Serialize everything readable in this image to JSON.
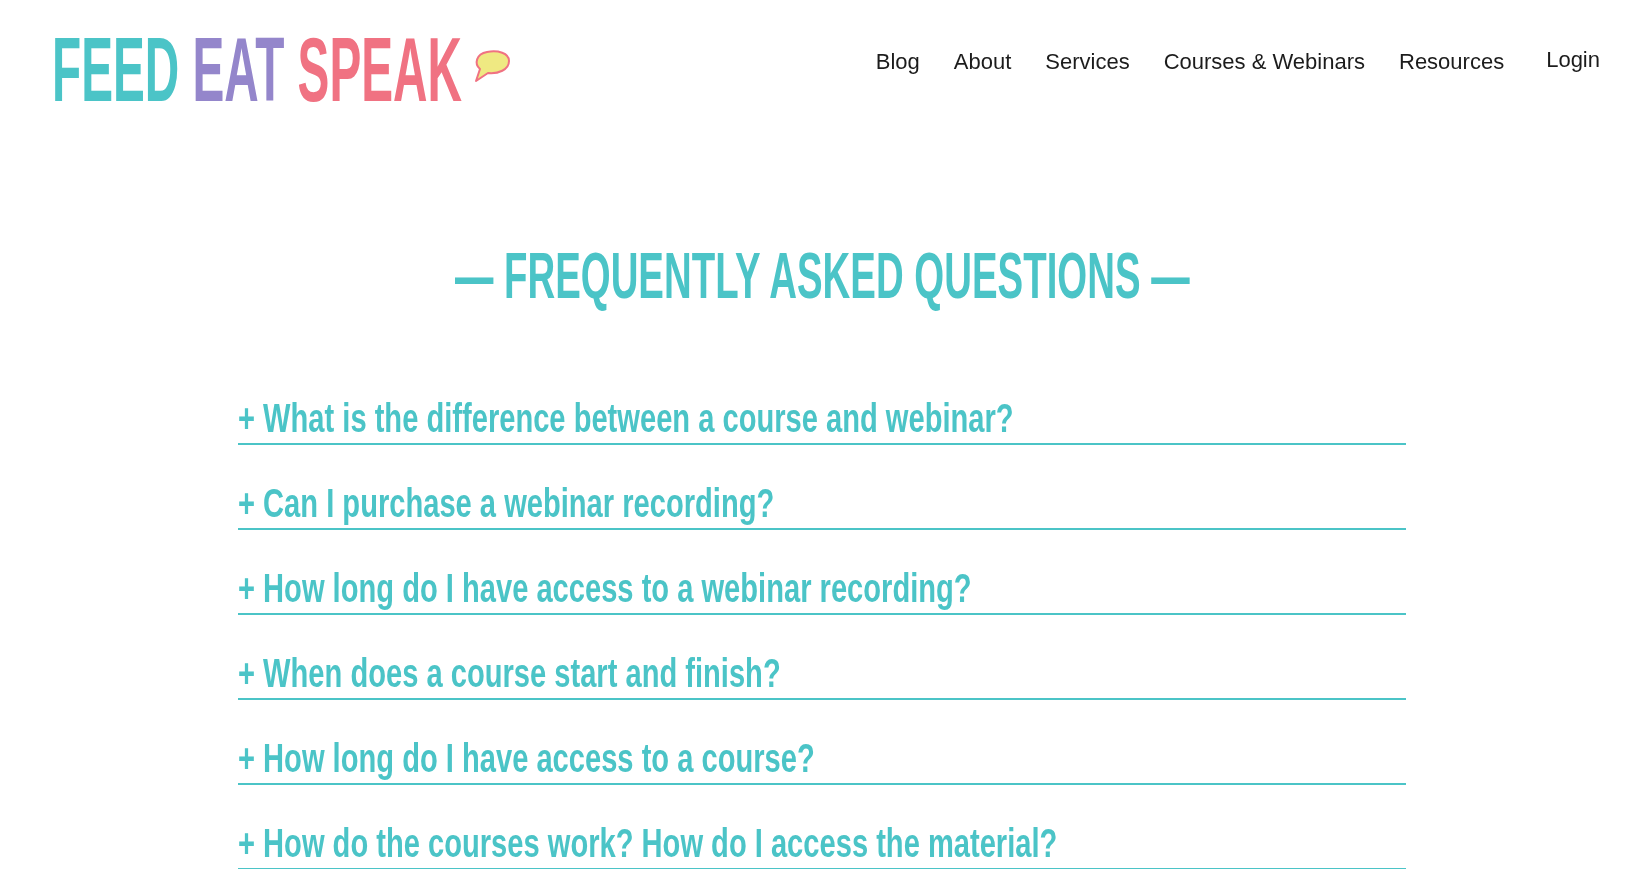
{
  "header": {
    "logo": {
      "words": [
        "FEED",
        "EAT",
        "SPEAK"
      ]
    },
    "nav": [
      {
        "label": "Blog"
      },
      {
        "label": "About"
      },
      {
        "label": "Services"
      },
      {
        "label": "Courses & Webinars"
      },
      {
        "label": "Resources"
      }
    ],
    "login": {
      "label": "Login"
    }
  },
  "faq": {
    "title": "— FREQUENTLY ASKED QUESTIONS —",
    "items": [
      {
        "question": "+ What is the difference between a course and webinar?"
      },
      {
        "question": "+ Can I purchase a webinar recording?"
      },
      {
        "question": "+ How long do I have access to a webinar recording?"
      },
      {
        "question": "+ When does a course start and finish?"
      },
      {
        "question": "+ How long do I have access to a course?"
      },
      {
        "question": "+ How do the courses work? How do I access the material?"
      }
    ]
  }
}
